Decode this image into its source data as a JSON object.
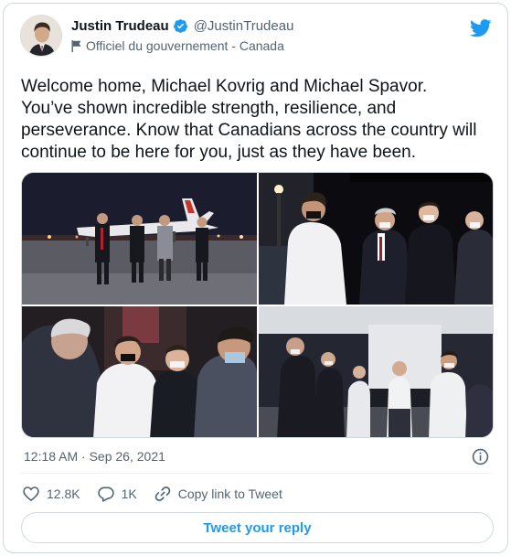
{
  "author": {
    "name": "Justin Trudeau",
    "handle": "@JustinTrudeau",
    "affiliation": "Officiel du gouvernement - Canada"
  },
  "tweet": {
    "text": "Welcome home, Michael Kovrig and Michael Spavor.\nYou’ve shown incredible strength, resilience, and\nperseverance. Know that Canadians across the country will\ncontinue to be here for you, just as they have been.",
    "timestamp": "12:18 AM · Sep 26, 2021"
  },
  "actions": {
    "likes": "12.8K",
    "replies": "1K",
    "copy_link_label": "Copy link to Tweet"
  },
  "reply_button_label": "Tweet your reply",
  "icons": {
    "brand": "twitter-bird-icon",
    "verified": "verified-badge-icon",
    "affiliation": "government-flag-icon",
    "info": "info-icon",
    "like": "heart-icon",
    "reply": "reply-bubble-icon",
    "copy": "link-icon"
  },
  "colors": {
    "accent": "#1d9bf0",
    "text": "#0f1419",
    "secondary": "#536471",
    "border": "#cfd9de"
  }
}
